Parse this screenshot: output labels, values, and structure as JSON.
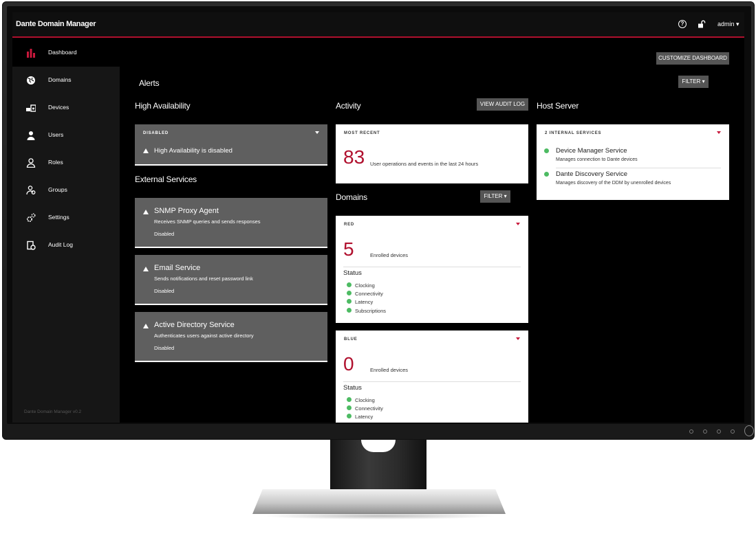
{
  "app": {
    "title": "Dante Domain Manager",
    "version": "Dante Domain Manager v0.2"
  },
  "topbar": {
    "help_icon": "question-circle-icon",
    "lock_icon": "unlock-icon",
    "user_menu": "admin ▾"
  },
  "colors": {
    "accent": "#b0102e",
    "status_ok": "#4dbb63",
    "card_grey": "#5f5f5f",
    "sidebar_bg": "#161616"
  },
  "sidebar": {
    "items": [
      {
        "label": "Dashboard",
        "icon": "bar-chart-icon",
        "active": true
      },
      {
        "label": "Domains",
        "icon": "globe-icon",
        "active": false
      },
      {
        "label": "Devices",
        "icon": "devices-icon",
        "active": false
      },
      {
        "label": "Users",
        "icon": "user-icon",
        "active": false
      },
      {
        "label": "Roles",
        "icon": "role-icon",
        "active": false
      },
      {
        "label": "Groups",
        "icon": "groups-icon",
        "active": false
      },
      {
        "label": "Settings",
        "icon": "gear-icon",
        "active": false
      },
      {
        "label": "Audit Log",
        "icon": "audit-log-icon",
        "active": false
      }
    ]
  },
  "main": {
    "customize_button": "CUSTOMIZE DASHBOARD",
    "alerts": {
      "title": "Alerts",
      "filter_button": "FILTER ▾"
    },
    "high_availability": {
      "title": "High Availability",
      "caption": "DISABLED",
      "message": "High Availability is disabled"
    },
    "external_services": {
      "title": "External Services",
      "items": [
        {
          "name": "SNMP Proxy Agent",
          "description": "Receives SNMP queries and sends responses",
          "state": "Disabled"
        },
        {
          "name": "Email Service",
          "description": "Sends notifications and reset password link",
          "state": "Disabled"
        },
        {
          "name": "Active Directory Service",
          "description": "Authenticates users against active directory",
          "state": "Disabled"
        }
      ]
    },
    "activity": {
      "title": "Activity",
      "audit_button": "VIEW AUDIT LOG",
      "caption": "MOST RECENT",
      "count": "83",
      "text": "User operations and events in the last 24 hours"
    },
    "domains": {
      "title": "Domains",
      "filter_button": "FILTER ▾",
      "cards": [
        {
          "caption": "RED",
          "count": "5",
          "count_text": "Enrolled devices",
          "status_title": "Status",
          "statuses": [
            "Clocking",
            "Connectivity",
            "Latency",
            "Subscriptions"
          ]
        },
        {
          "caption": "BLUE",
          "count": "0",
          "count_text": "Enrolled devices",
          "status_title": "Status",
          "statuses": [
            "Clocking",
            "Connectivity",
            "Latency"
          ]
        }
      ]
    },
    "host_server": {
      "title": "Host Server",
      "caption": "2 INTERNAL SERVICES",
      "items": [
        {
          "name": "Device Manager Service",
          "description": "Manages connection to Dante devices"
        },
        {
          "name": "Dante Discovery Service",
          "description": "Manages discovery of the DDM by unenrolled devices"
        }
      ]
    }
  }
}
